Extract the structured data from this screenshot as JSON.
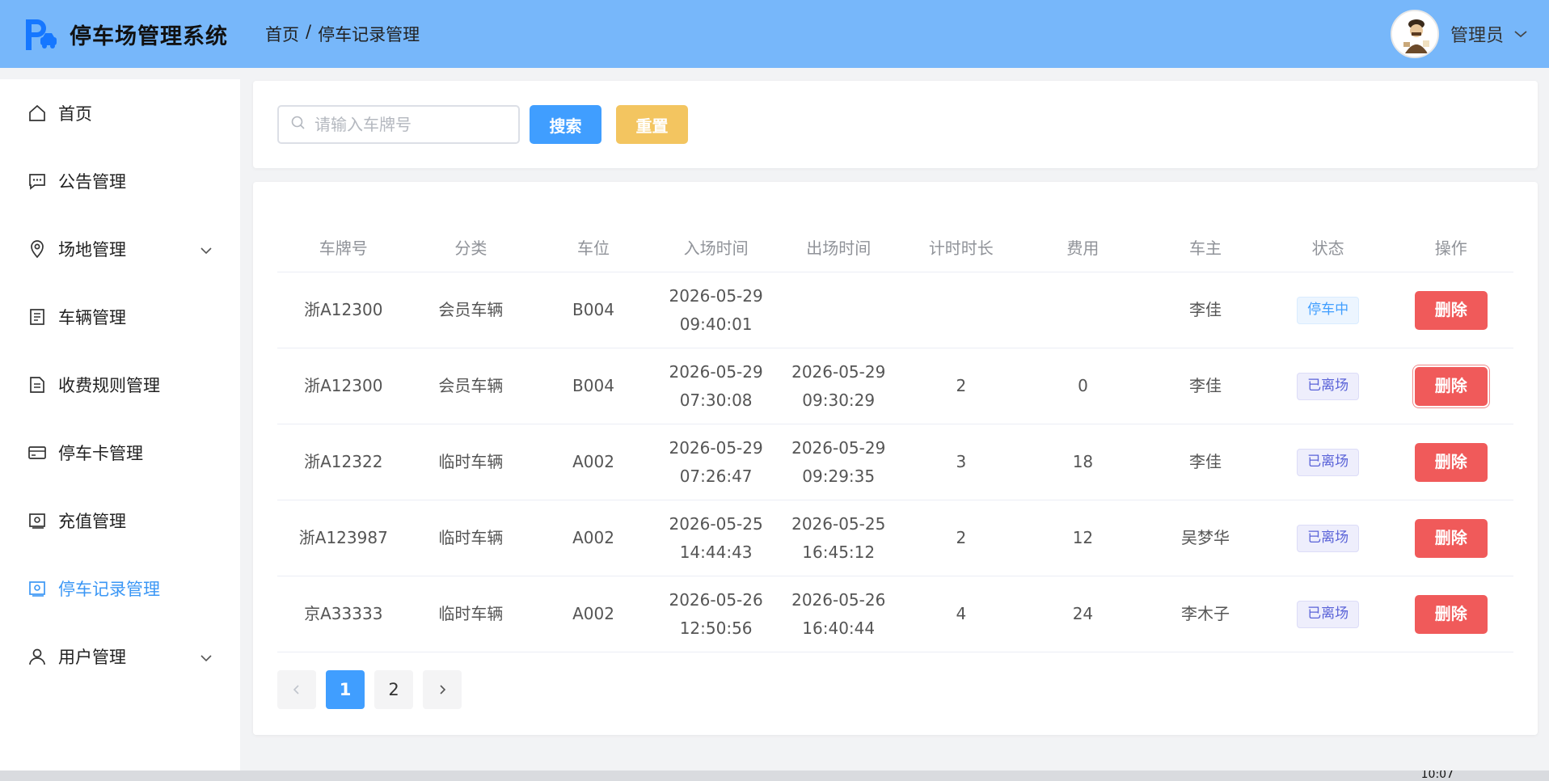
{
  "header": {
    "app_title": "停车场管理系统",
    "breadcrumb": [
      "首页",
      "/",
      "停车记录管理"
    ],
    "user_name": "管理员",
    "accent_color": "#77b7fa"
  },
  "sidebar": {
    "items": [
      {
        "label": "首页",
        "icon": "home-icon"
      },
      {
        "label": "公告管理",
        "icon": "message-icon"
      },
      {
        "label": "场地管理",
        "icon": "location-icon",
        "has_submenu": true
      },
      {
        "label": "车辆管理",
        "icon": "document-icon"
      },
      {
        "label": "收费规则管理",
        "icon": "document-icon"
      },
      {
        "label": "停车卡管理",
        "icon": "card-icon"
      },
      {
        "label": "充值管理",
        "icon": "wallet-icon"
      },
      {
        "label": "停车记录管理",
        "icon": "wallet-icon",
        "active": true
      },
      {
        "label": "用户管理",
        "icon": "user-icon",
        "has_submenu": true
      }
    ]
  },
  "search": {
    "placeholder": "请输入车牌号",
    "value": "",
    "search_label": "搜索",
    "reset_label": "重置"
  },
  "table": {
    "columns": [
      "车牌号",
      "分类",
      "车位",
      "入场时间",
      "出场时间",
      "计时时长",
      "费用",
      "车主",
      "状态",
      "操作"
    ],
    "rows": [
      {
        "plate": "浙A12300",
        "category": "会员车辆",
        "space": "B004",
        "in_date": "2026-05-29",
        "in_time": "09:40:01",
        "out_date": "",
        "out_time": "",
        "duration": "",
        "fee": "",
        "owner": "李佳",
        "status": "停车中",
        "action": "删除"
      },
      {
        "plate": "浙A12300",
        "category": "会员车辆",
        "space": "B004",
        "in_date": "2026-05-29",
        "in_time": "07:30:08",
        "out_date": "2026-05-29",
        "out_time": "09:30:29",
        "duration": "2",
        "fee": "0",
        "owner": "李佳",
        "status": "已离场",
        "action": "删除"
      },
      {
        "plate": "浙A12322",
        "category": "临时车辆",
        "space": "A002",
        "in_date": "2026-05-29",
        "in_time": "07:26:47",
        "out_date": "2026-05-29",
        "out_time": "09:29:35",
        "duration": "3",
        "fee": "18",
        "owner": "李佳",
        "status": "已离场",
        "action": "删除"
      },
      {
        "plate": "浙A123987",
        "category": "临时车辆",
        "space": "A002",
        "in_date": "2026-05-25",
        "in_time": "14:44:43",
        "out_date": "2026-05-25",
        "out_time": "16:45:12",
        "duration": "2",
        "fee": "12",
        "owner": "吴梦华",
        "status": "已离场",
        "action": "删除"
      },
      {
        "plate": "京A33333",
        "category": "临时车辆",
        "space": "A002",
        "in_date": "2026-05-26",
        "in_time": "12:50:56",
        "out_date": "2026-05-26",
        "out_time": "16:40:44",
        "duration": "4",
        "fee": "24",
        "owner": "李木子",
        "status": "已离场",
        "action": "删除"
      }
    ]
  },
  "pagination": {
    "pages": [
      "1",
      "2"
    ],
    "current": "1"
  },
  "taskbar": {
    "clock": "10:07"
  }
}
